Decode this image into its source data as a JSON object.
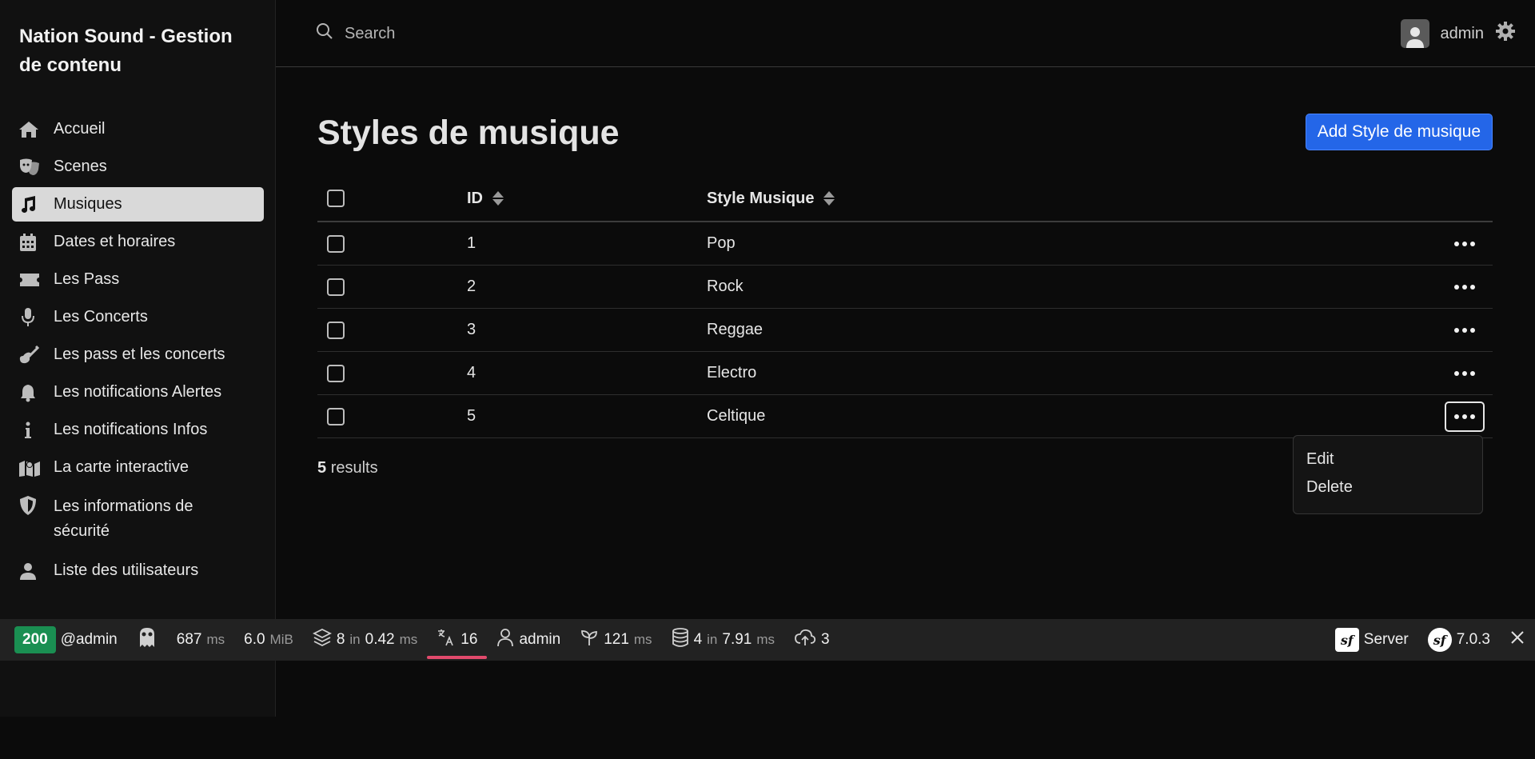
{
  "app": {
    "title": "Nation Sound - Gestion de contenu"
  },
  "sidebar": {
    "items": [
      {
        "label": "Accueil",
        "icon": "home-icon"
      },
      {
        "label": "Scenes",
        "icon": "theater-masks-icon"
      },
      {
        "label": "Musiques",
        "icon": "music-note-icon",
        "active": true
      },
      {
        "label": "Dates et horaires",
        "icon": "calendar-icon"
      },
      {
        "label": "Les Pass",
        "icon": "ticket-icon"
      },
      {
        "label": "Les Concerts",
        "icon": "microphone-icon"
      },
      {
        "label": "Les pass et les concerts",
        "icon": "guitar-icon"
      },
      {
        "label": "Les notifications Alertes",
        "icon": "bell-icon"
      },
      {
        "label": "Les notifications Infos",
        "icon": "info-icon"
      },
      {
        "label": "La carte interactive",
        "icon": "map-marker-icon"
      },
      {
        "label": "Les informations de sécurité",
        "icon": "shield-icon"
      },
      {
        "label": "Liste des utilisateurs",
        "icon": "user-icon"
      }
    ]
  },
  "topbar": {
    "search_placeholder": "Search",
    "user_name": "admin"
  },
  "main": {
    "title": "Styles de musique",
    "add_button": "Add Style de musique",
    "columns": {
      "id": "ID",
      "style": "Style Musique"
    },
    "rows": [
      {
        "id": "1",
        "style": "Pop"
      },
      {
        "id": "2",
        "style": "Rock"
      },
      {
        "id": "3",
        "style": "Reggae"
      },
      {
        "id": "4",
        "style": "Electro"
      },
      {
        "id": "5",
        "style": "Celtique"
      }
    ],
    "results_count": "5",
    "results_label": "results"
  },
  "actions_menu": {
    "edit": "Edit",
    "delete": "Delete"
  },
  "debug_toolbar": {
    "status": "200",
    "user_tag": "@admin",
    "time_value": "687",
    "time_unit": "ms",
    "memory_value": "6.0",
    "memory_unit": "MiB",
    "cache_count": "8",
    "cache_in": "in",
    "cache_time": "0.42",
    "cache_unit": "ms",
    "translation_count": "16",
    "security_user": "admin",
    "twig_time": "121",
    "twig_unit": "ms",
    "db_count": "4",
    "db_in": "in",
    "db_time": "7.91",
    "db_unit": "ms",
    "uploads_count": "3",
    "server_label": "Server",
    "symfony_version": "7.0.3",
    "accent_color": "#1a8f52",
    "translation_underline_color": "#e24a6c"
  },
  "colors": {
    "primary_button": "#2466e8",
    "background": "#0b0b0b",
    "sidebar_active": "#d9d9d9"
  }
}
